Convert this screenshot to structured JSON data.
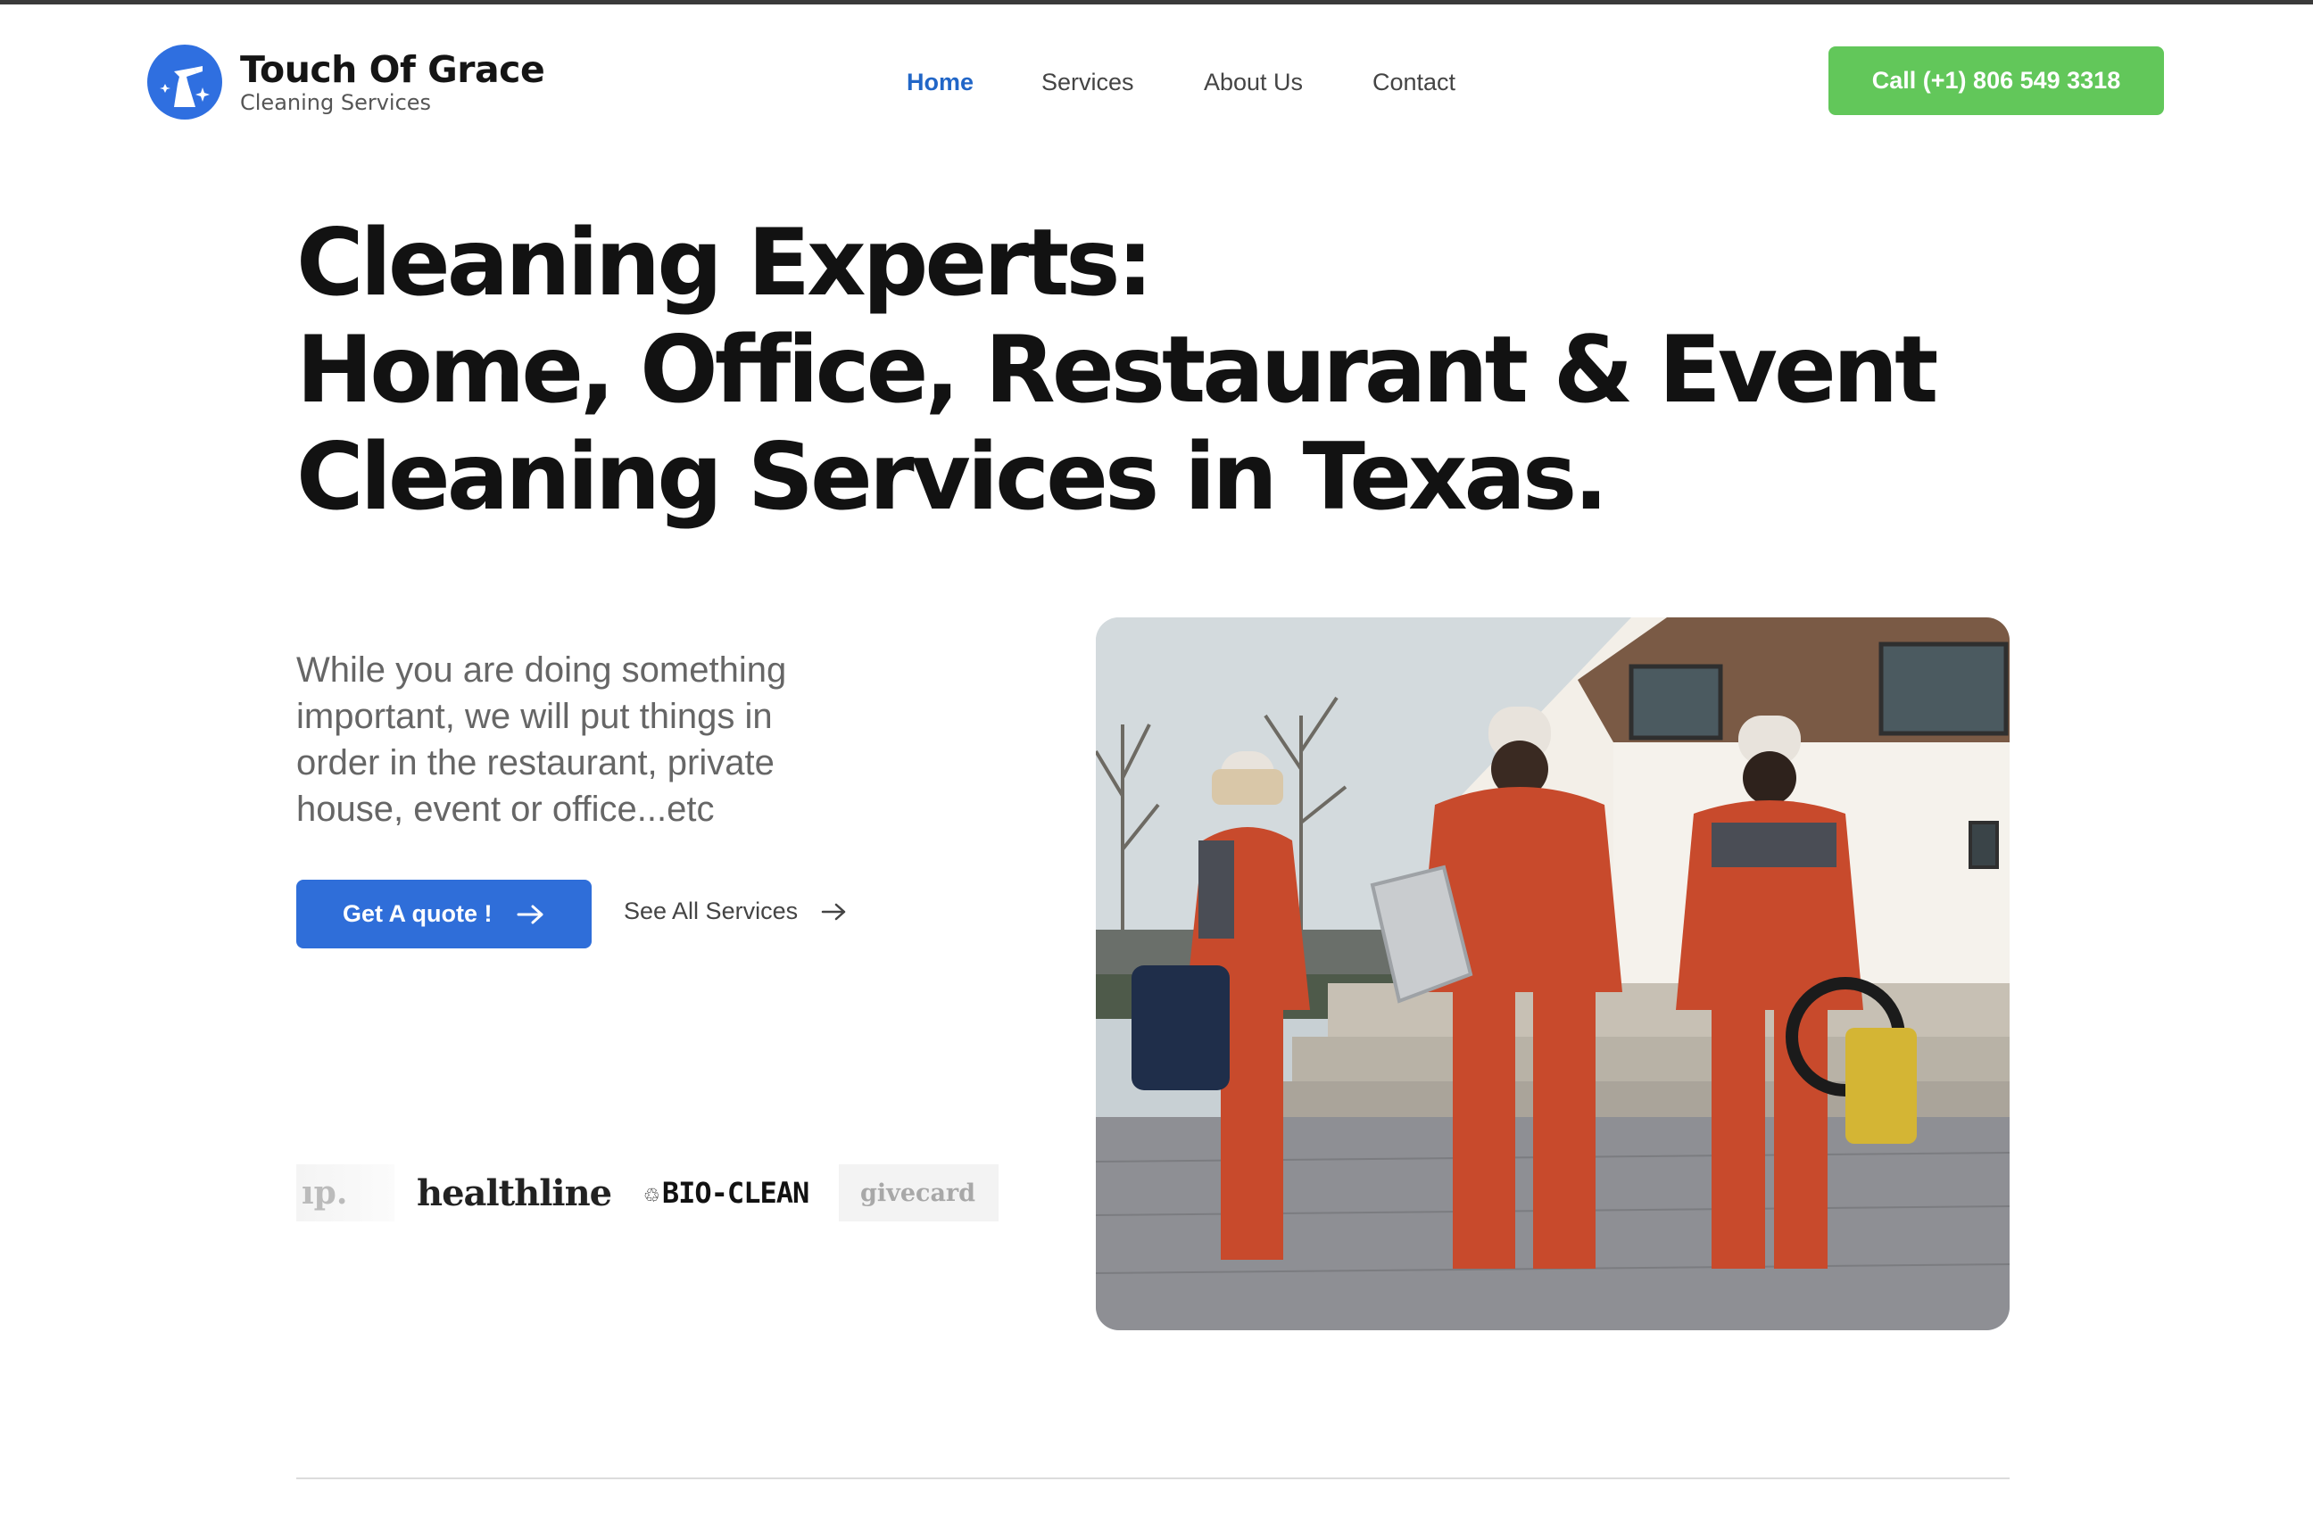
{
  "header": {
    "brand_name": "Touch Of Grace",
    "brand_tagline": "Cleaning Services",
    "nav": [
      {
        "label": "Home",
        "active": true
      },
      {
        "label": "Services",
        "active": false
      },
      {
        "label": "About Us",
        "active": false
      },
      {
        "label": "Contact",
        "active": false
      }
    ],
    "call_button": "Call (+1) 806 549 3318"
  },
  "hero": {
    "title_lines": [
      "Cleaning Experts:",
      "Home, Office, Restaurant & Event",
      "Cleaning Services in Texas."
    ],
    "description": "While you are doing something important, we will put things in order in the restaurant, private house, event or office...etc",
    "primary_button": "Get A quote !",
    "secondary_link": "See All Services",
    "photo_icon": "cleaning-crew-photo"
  },
  "partner_logos": [
    {
      "name": "p-logo",
      "text": "ıp."
    },
    {
      "name": "healthline-logo",
      "text": "healthline"
    },
    {
      "name": "bio-clean-logo",
      "text": "BIO-CLEAN"
    },
    {
      "name": "givecard-logo",
      "text": "givecard"
    }
  ],
  "colors": {
    "accent_blue": "#2f6ed9",
    "nav_active": "#2166c7",
    "call_green": "#62c75a",
    "title_text": "#121212"
  }
}
